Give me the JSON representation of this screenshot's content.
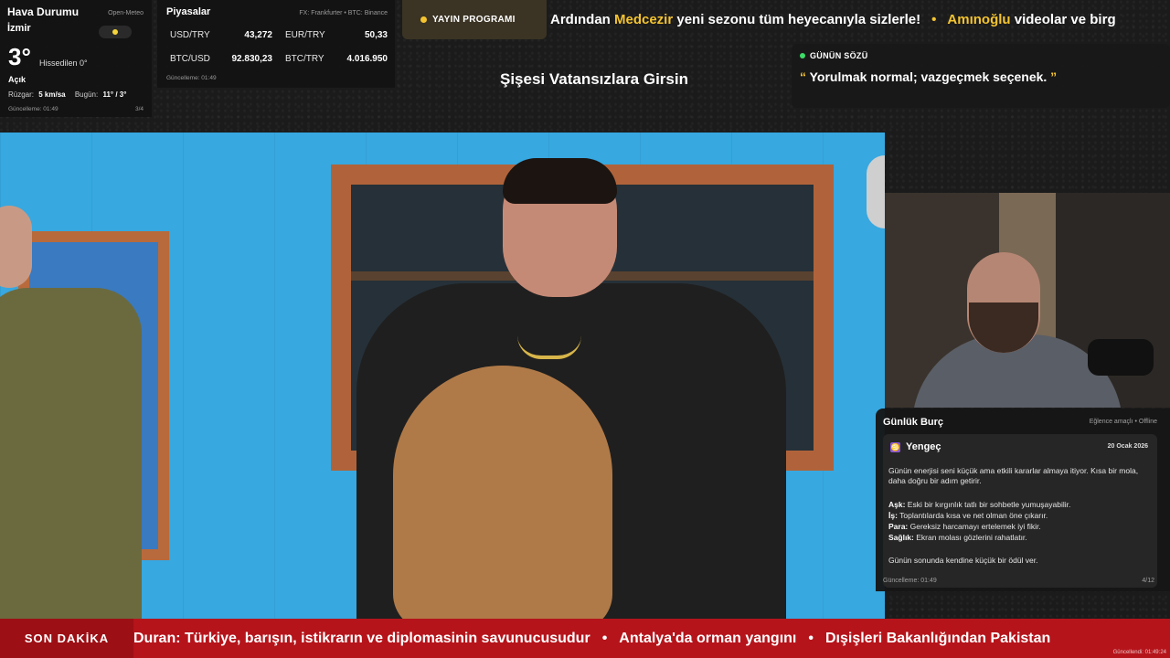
{
  "weather": {
    "title": "Hava Durumu",
    "source": "Open-Meteo",
    "city": "İzmir",
    "temperature": "3°",
    "feels_like": "Hissedilen 0°",
    "condition": "Açık",
    "wind_label": "Rüzgar:",
    "wind_value": "5 km/sa",
    "today_label": "Bugün:",
    "today_value": "11° / 3°",
    "updated": "Güncelleme: 01:49",
    "page": "3/4"
  },
  "markets": {
    "title": "Piyasalar",
    "source": "FX: Frankfurter • BTC: Binance",
    "rates": [
      {
        "label": "USD/TRY",
        "value": "43,272"
      },
      {
        "label": "EUR/TRY",
        "value": "50,33"
      },
      {
        "label": "BTC/USD",
        "value": "92.830,23"
      },
      {
        "label": "BTC/TRY",
        "value": "4.016.950"
      }
    ],
    "updated": "Güncelleme: 01:49"
  },
  "schedule": {
    "button_label": "YAYIN PROGRAMI",
    "ticker": [
      {
        "pre": "Ardından ",
        "highlight": "Medcezir",
        "post": " yeni sezonu tüm heyecanıyla sizlerle!"
      },
      {
        "pre": "",
        "highlight": "Amınoğlu",
        "post": " videolar ve birg"
      }
    ],
    "separator": "•"
  },
  "show_title": "Şişesi Vatansızlara Girsin",
  "quote": {
    "label": "GÜNÜN SÖZÜ",
    "open_mark": "“",
    "text": " Yorulmak normal; vazgeçmek seçenek. ",
    "close_mark": "”"
  },
  "horoscope": {
    "title": "Günlük Burç",
    "status": "Eğlence amaçlı • Offline",
    "sign_symbol": "♋",
    "sign": "Yengeç",
    "date": "20 Ocak 2026",
    "intro": "Günün enerjisi seni küçük ama etkili kararlar almaya itiyor. Kısa bir mola, daha doğru bir adım getirir.",
    "lines": [
      {
        "label": "Aşk:",
        "text": " Eski bir kırgınlık tatlı bir sohbetle yumuşayabilir."
      },
      {
        "label": "İş:",
        "text": " Toplantılarda kısa ve net olman öne çıkarır."
      },
      {
        "label": "Para:",
        "text": " Gereksiz harcamayı ertelemek iyi fikir."
      },
      {
        "label": "Sağlık:",
        "text": " Ekran molası gözlerini rahatlatır."
      }
    ],
    "closing": "Günün sonunda kendine küçük bir ödül ver.",
    "updated": "Güncelleme: 01:49",
    "page": "4/12"
  },
  "breaking": {
    "label": "SON DAKİKA",
    "items": [
      "Duran: Türkiye, barışın, istikrarın ve diplomasinin savunucusudur",
      "Antalya'da orman yangını",
      "Dışişleri Bakanlığından Pakistan"
    ],
    "separator": "•",
    "updated": "Güncellendi: 01:49:24"
  },
  "colors": {
    "accent": "#f4c430",
    "breaking_bg": "#b5141b",
    "quote_dot": "#3ddc68"
  }
}
